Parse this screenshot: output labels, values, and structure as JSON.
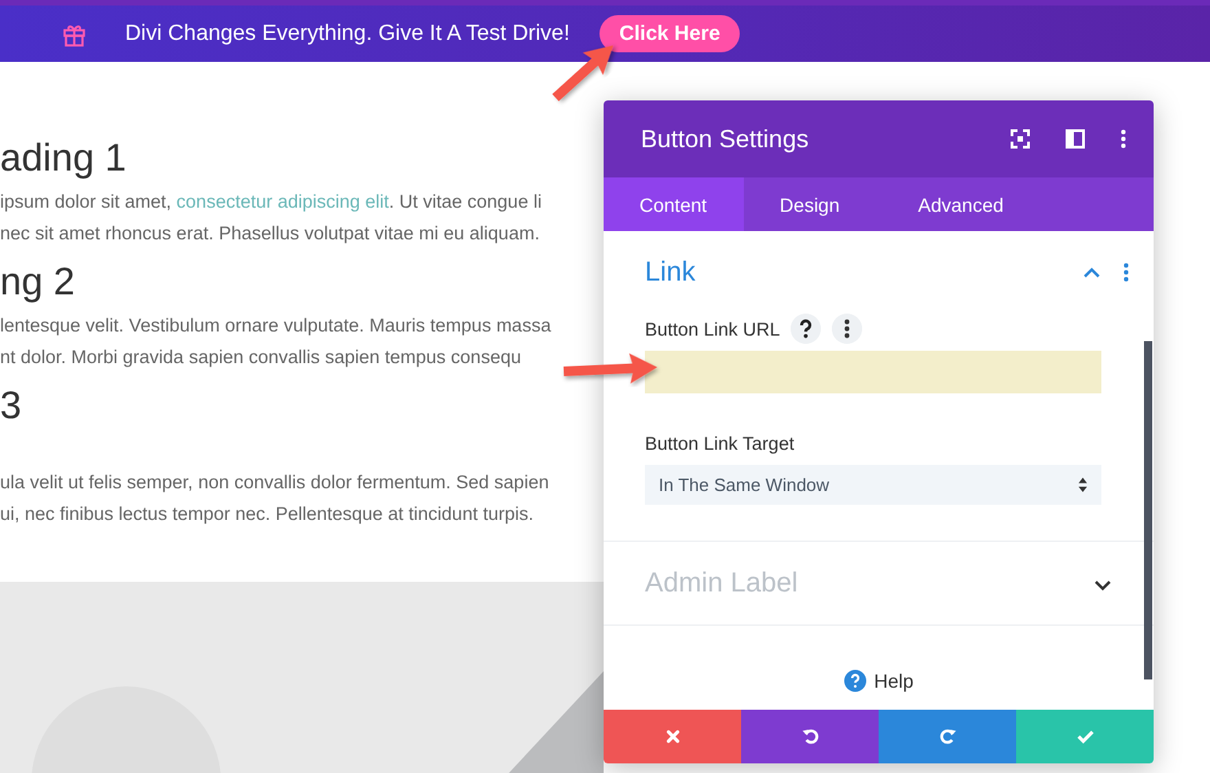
{
  "promo_bar": {
    "message": "Divi Changes Everything. Give It A Test Drive!",
    "button": "Click Here"
  },
  "page": {
    "blocks": [
      {
        "kind": "heading",
        "text": "ading 1"
      },
      {
        "kind": "line",
        "parts": [
          {
            "kind": "text",
            "text": "ipsum dolor sit amet, "
          },
          {
            "kind": "link",
            "text": "consectetur adipiscing elit"
          },
          {
            "kind": "text",
            "text": ". Ut vitae congue li"
          }
        ]
      },
      {
        "kind": "line",
        "parts": [
          {
            "kind": "text",
            "text": "nec sit amet rhoncus erat. Phasellus volutpat vitae mi eu aliquam."
          }
        ]
      },
      {
        "kind": "heading",
        "text": "ng 2"
      },
      {
        "kind": "line",
        "parts": [
          {
            "kind": "text",
            "text": "lentesque velit. Vestibulum ornare vulputate. Mauris tempus massa"
          }
        ]
      },
      {
        "kind": "line",
        "parts": [
          {
            "kind": "text",
            "text": "nt dolor. Morbi gravida sapien convallis sapien tempus consequ"
          }
        ]
      },
      {
        "kind": "heading",
        "text": "3"
      },
      {
        "kind": "gap"
      },
      {
        "kind": "line",
        "parts": [
          {
            "kind": "text",
            "text": "ula velit ut felis semper, non convallis dolor fermentum. Sed sapien"
          }
        ]
      },
      {
        "kind": "line",
        "parts": [
          {
            "kind": "text",
            "text": "ui, nec finibus lectus tempor nec. Pellentesque at tincidunt turpis."
          }
        ]
      }
    ]
  },
  "settings": {
    "title": "Button Settings",
    "tabs": [
      {
        "label": "Content",
        "selected": true
      },
      {
        "label": "Design",
        "selected": false
      },
      {
        "label": "Advanced",
        "selected": false
      }
    ],
    "sections": [
      {
        "title": "Link",
        "expanded": true,
        "fields": [
          {
            "kind": "text",
            "label": "Button Link URL",
            "highlighted": true
          },
          {
            "kind": "select",
            "label": "Button Link Target",
            "value": "In The Same Window"
          }
        ]
      },
      {
        "title": "Admin Label",
        "expanded": false
      }
    ],
    "help": "Help",
    "actions": [
      {
        "kind": "discard",
        "color": "#ef5555"
      },
      {
        "kind": "undo",
        "color": "#7e3bd0"
      },
      {
        "kind": "redo",
        "color": "#2b87da"
      },
      {
        "kind": "save",
        "color": "#29c4a9"
      }
    ]
  }
}
